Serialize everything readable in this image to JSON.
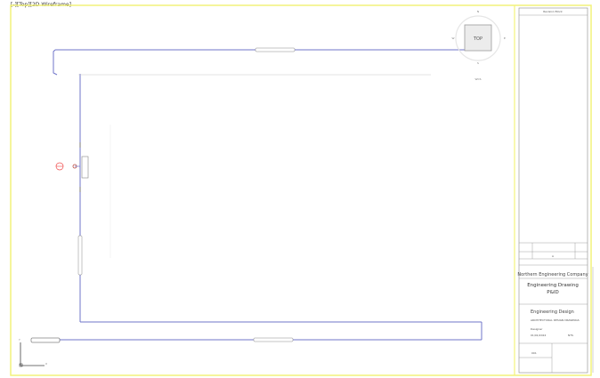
{
  "viewport": {
    "label": "[-][Top][2D Wireframe]"
  },
  "viewcube": {
    "face": "TOP",
    "compass": {
      "north": "N",
      "south": "S",
      "east": "E",
      "west": "W"
    },
    "wcs": "WCS"
  },
  "ucs": {
    "x": "X",
    "y": "Y"
  },
  "colors": {
    "yellow_border": "#f2f27a",
    "pipe_blue": "#6f74c9",
    "red_symbol": "#f04a4a",
    "titleblock_line": "#8a8a8a"
  },
  "titleblock": {
    "revision_header": "Revision Block",
    "project_company": "Northern Engineering Company",
    "drawing_title_lines": [
      "Engineering Drawing",
      "P&ID"
    ],
    "notes": [
      "Engineering Design",
      "ARCHITECTURAL DESIGN DRAWINGS"
    ],
    "drawn_by": "Designer",
    "date": "01/01/2024",
    "scale": "NTS",
    "sheet_no": "001",
    "revision": "A"
  }
}
